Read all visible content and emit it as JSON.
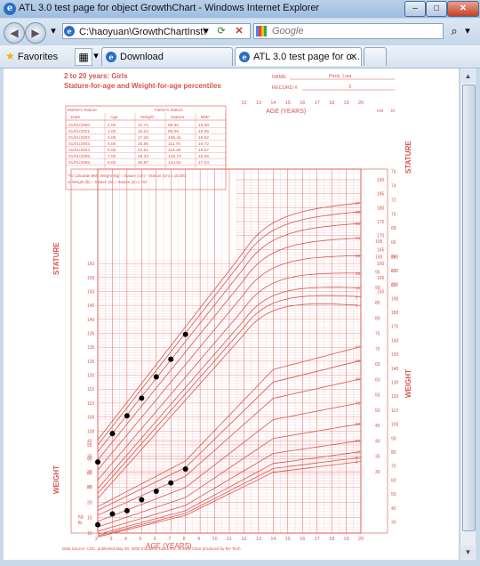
{
  "window": {
    "title": "ATL 3.0 test page for object GrowthChart - Windows Internet Explorer",
    "buttons": {
      "minimize": "–",
      "maximize": "□",
      "close": "✕"
    }
  },
  "address_bar": {
    "back": "◀",
    "forward": "▶",
    "url": "C:\\haoyuan\\GrowthChartInst\\",
    "dropdown": "▾",
    "refresh": "⟳",
    "stop": "✕",
    "search_placeholder": "Google",
    "search_go": "⌕"
  },
  "favorites_bar": {
    "favorites_label": "Favorites",
    "grid_glyph": "▦",
    "tabs": [
      {
        "label": "Download",
        "active": false
      },
      {
        "label": "ATL 3.0 test page for o...",
        "active": true
      }
    ]
  },
  "chart": {
    "heading1": "2 to 20 years: Girls",
    "heading2": "Stature-for-age and Weight-for-age percentiles",
    "name_label": "NAME",
    "name_value": "Peck, Lisa",
    "record_label": "RECORD #",
    "record_value": "3",
    "mother_label": "Mother's Stature",
    "father_label": "Father's Stature",
    "table_headers": [
      "Date",
      "Age",
      "Weight",
      "Stature",
      "BMI*"
    ],
    "table_rows": [
      [
        "01/01/2000",
        "2.00",
        "12.71",
        "88.90",
        "16.08"
      ],
      [
        "01/01/2001",
        "3.00",
        "16.24",
        "99.06",
        "16.55"
      ],
      [
        "01/01/2002",
        "4.00",
        "17.26",
        "105.41",
        "15.52"
      ],
      [
        "01/01/2003",
        "5.00",
        "20.85",
        "111.76",
        "16.72"
      ],
      [
        "01/01/2004",
        "6.00",
        "23.61",
        "119.38",
        "16.57"
      ],
      [
        "01/01/2005",
        "7.00",
        "26.33",
        "125.73",
        "16.66"
      ],
      [
        "01/01/2006",
        "8.00",
        "30.87",
        "134.62",
        "17.03"
      ]
    ],
    "bmi_note": "*To Calculate BMI: Weight (kg) ÷ Stature (cm) ÷ Stature (cm) x 10,000",
    "bmi_note2": "or Weight (lb) ÷ Stature (in) ÷ Stature (in) x 703",
    "age_years_label": "AGE (YEARS)",
    "stature_label": "STATURE",
    "weight_label": "WEIGHT",
    "cm_label": "cm",
    "in_label": "in",
    "kg_label": "kg",
    "lb_label": "lb",
    "footer": "Data Source: CDC, published May 30, 2000 (modified 11/21/00). Growth Chart produced by BV Tech",
    "percentile_labels": [
      "97",
      "95",
      "90",
      "75",
      "50",
      "25",
      "10",
      "5",
      "3"
    ],
    "line_color": "#d9534f",
    "dot_color": "#000000"
  },
  "chart_data": {
    "type": "scatter",
    "series": [
      {
        "name": "Stature",
        "x": [
          2,
          3,
          4,
          5,
          6,
          7,
          8
        ],
        "values": [
          88.9,
          99.06,
          105.41,
          111.76,
          119.38,
          125.73,
          134.62
        ]
      },
      {
        "name": "Weight",
        "x": [
          2,
          3,
          4,
          5,
          6,
          7,
          8
        ],
        "values": [
          12.71,
          16.24,
          17.26,
          20.85,
          23.61,
          26.33,
          30.87
        ]
      }
    ],
    "xlabel": "AGE (YEARS)",
    "xlim": [
      2,
      20
    ],
    "stature_ylim": [
      80,
      190
    ],
    "weight_ylim": [
      10,
      105
    ]
  }
}
